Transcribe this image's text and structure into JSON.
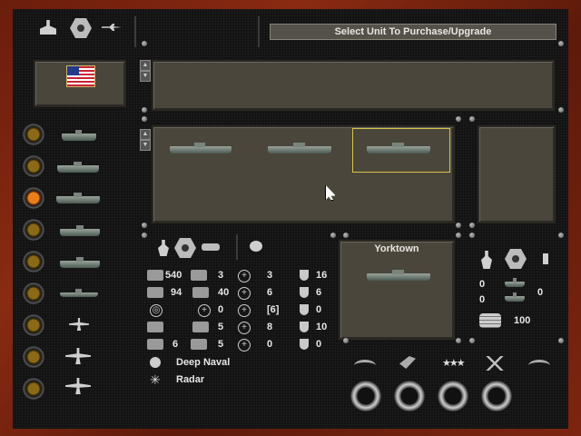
{
  "header": {
    "title": "Select Unit To Purchase/Upgrade"
  },
  "side_units": [
    {
      "name": "destroyer",
      "active": false
    },
    {
      "name": "cruiser",
      "active": false
    },
    {
      "name": "carrier",
      "active": true
    },
    {
      "name": "battleship",
      "active": false
    },
    {
      "name": "transport",
      "active": false
    },
    {
      "name": "submarine",
      "active": false
    },
    {
      "name": "fighter",
      "active": false
    },
    {
      "name": "bomber",
      "active": false
    },
    {
      "name": "transport-plane",
      "active": false
    }
  ],
  "selected": {
    "name": "Yorktown",
    "class_type": "Deep Naval",
    "special": "Radar"
  },
  "stats": {
    "col1": [
      "540",
      "94",
      "",
      "",
      "6"
    ],
    "col2": [
      "3",
      "40",
      "0",
      "5",
      "5"
    ],
    "col3": [
      "3",
      "6",
      "[6]",
      "8",
      "0"
    ],
    "col4": [
      "16",
      "6",
      "0",
      "10",
      "0"
    ]
  },
  "purchase": {
    "count_a": "0",
    "count_b": "0",
    "count_c": "0",
    "cost": "100"
  },
  "colors": {
    "accent": "#d6c34a",
    "frame": "#7c2510"
  }
}
